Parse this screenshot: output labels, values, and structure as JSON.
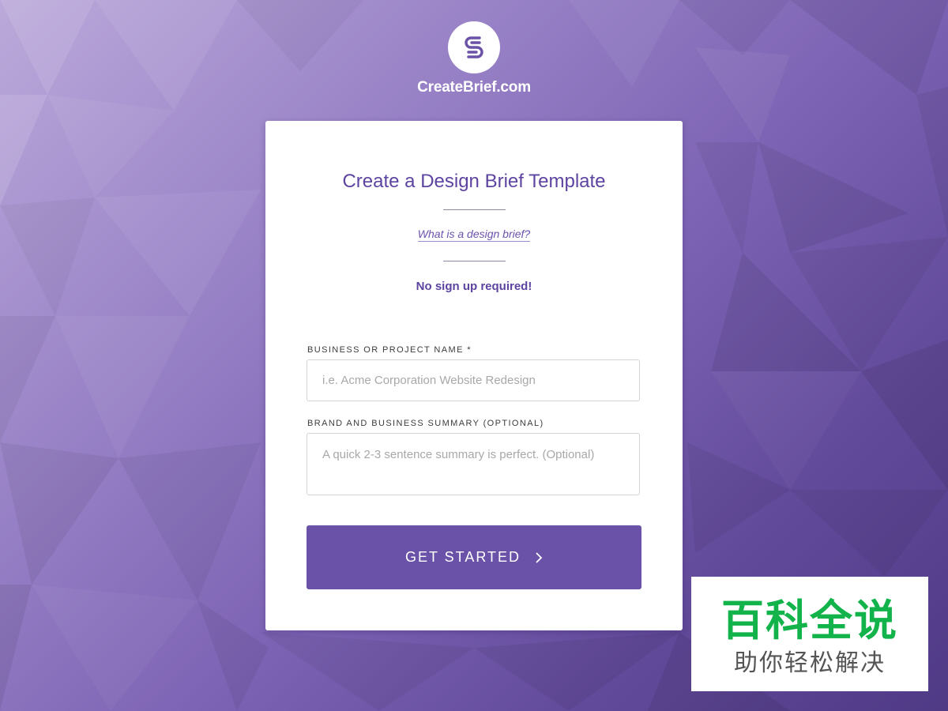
{
  "brand": {
    "name": "CreateBrief.com",
    "logo_icon": "s-logo-icon"
  },
  "form": {
    "title": "Create a Design Brief Template",
    "help_link": "What is a design brief?",
    "tagline": "No sign up required!",
    "fields": [
      {
        "label": "BUSINESS OR PROJECT NAME *",
        "placeholder": "i.e. Acme Corporation Website Redesign",
        "value": ""
      },
      {
        "label": "BRAND AND BUSINESS SUMMARY (OPTIONAL)",
        "placeholder": "A quick 2-3 sentence summary is perfect. (Optional)",
        "value": ""
      }
    ],
    "submit_label": "GET STARTED",
    "submit_icon": "chevron-right-icon"
  },
  "watermark": {
    "title": "百科全说",
    "subtitle": "助你轻松解决"
  },
  "colors": {
    "accent": "#6a52a8",
    "title": "#5d44a1",
    "watermark_green": "#12b34a"
  }
}
